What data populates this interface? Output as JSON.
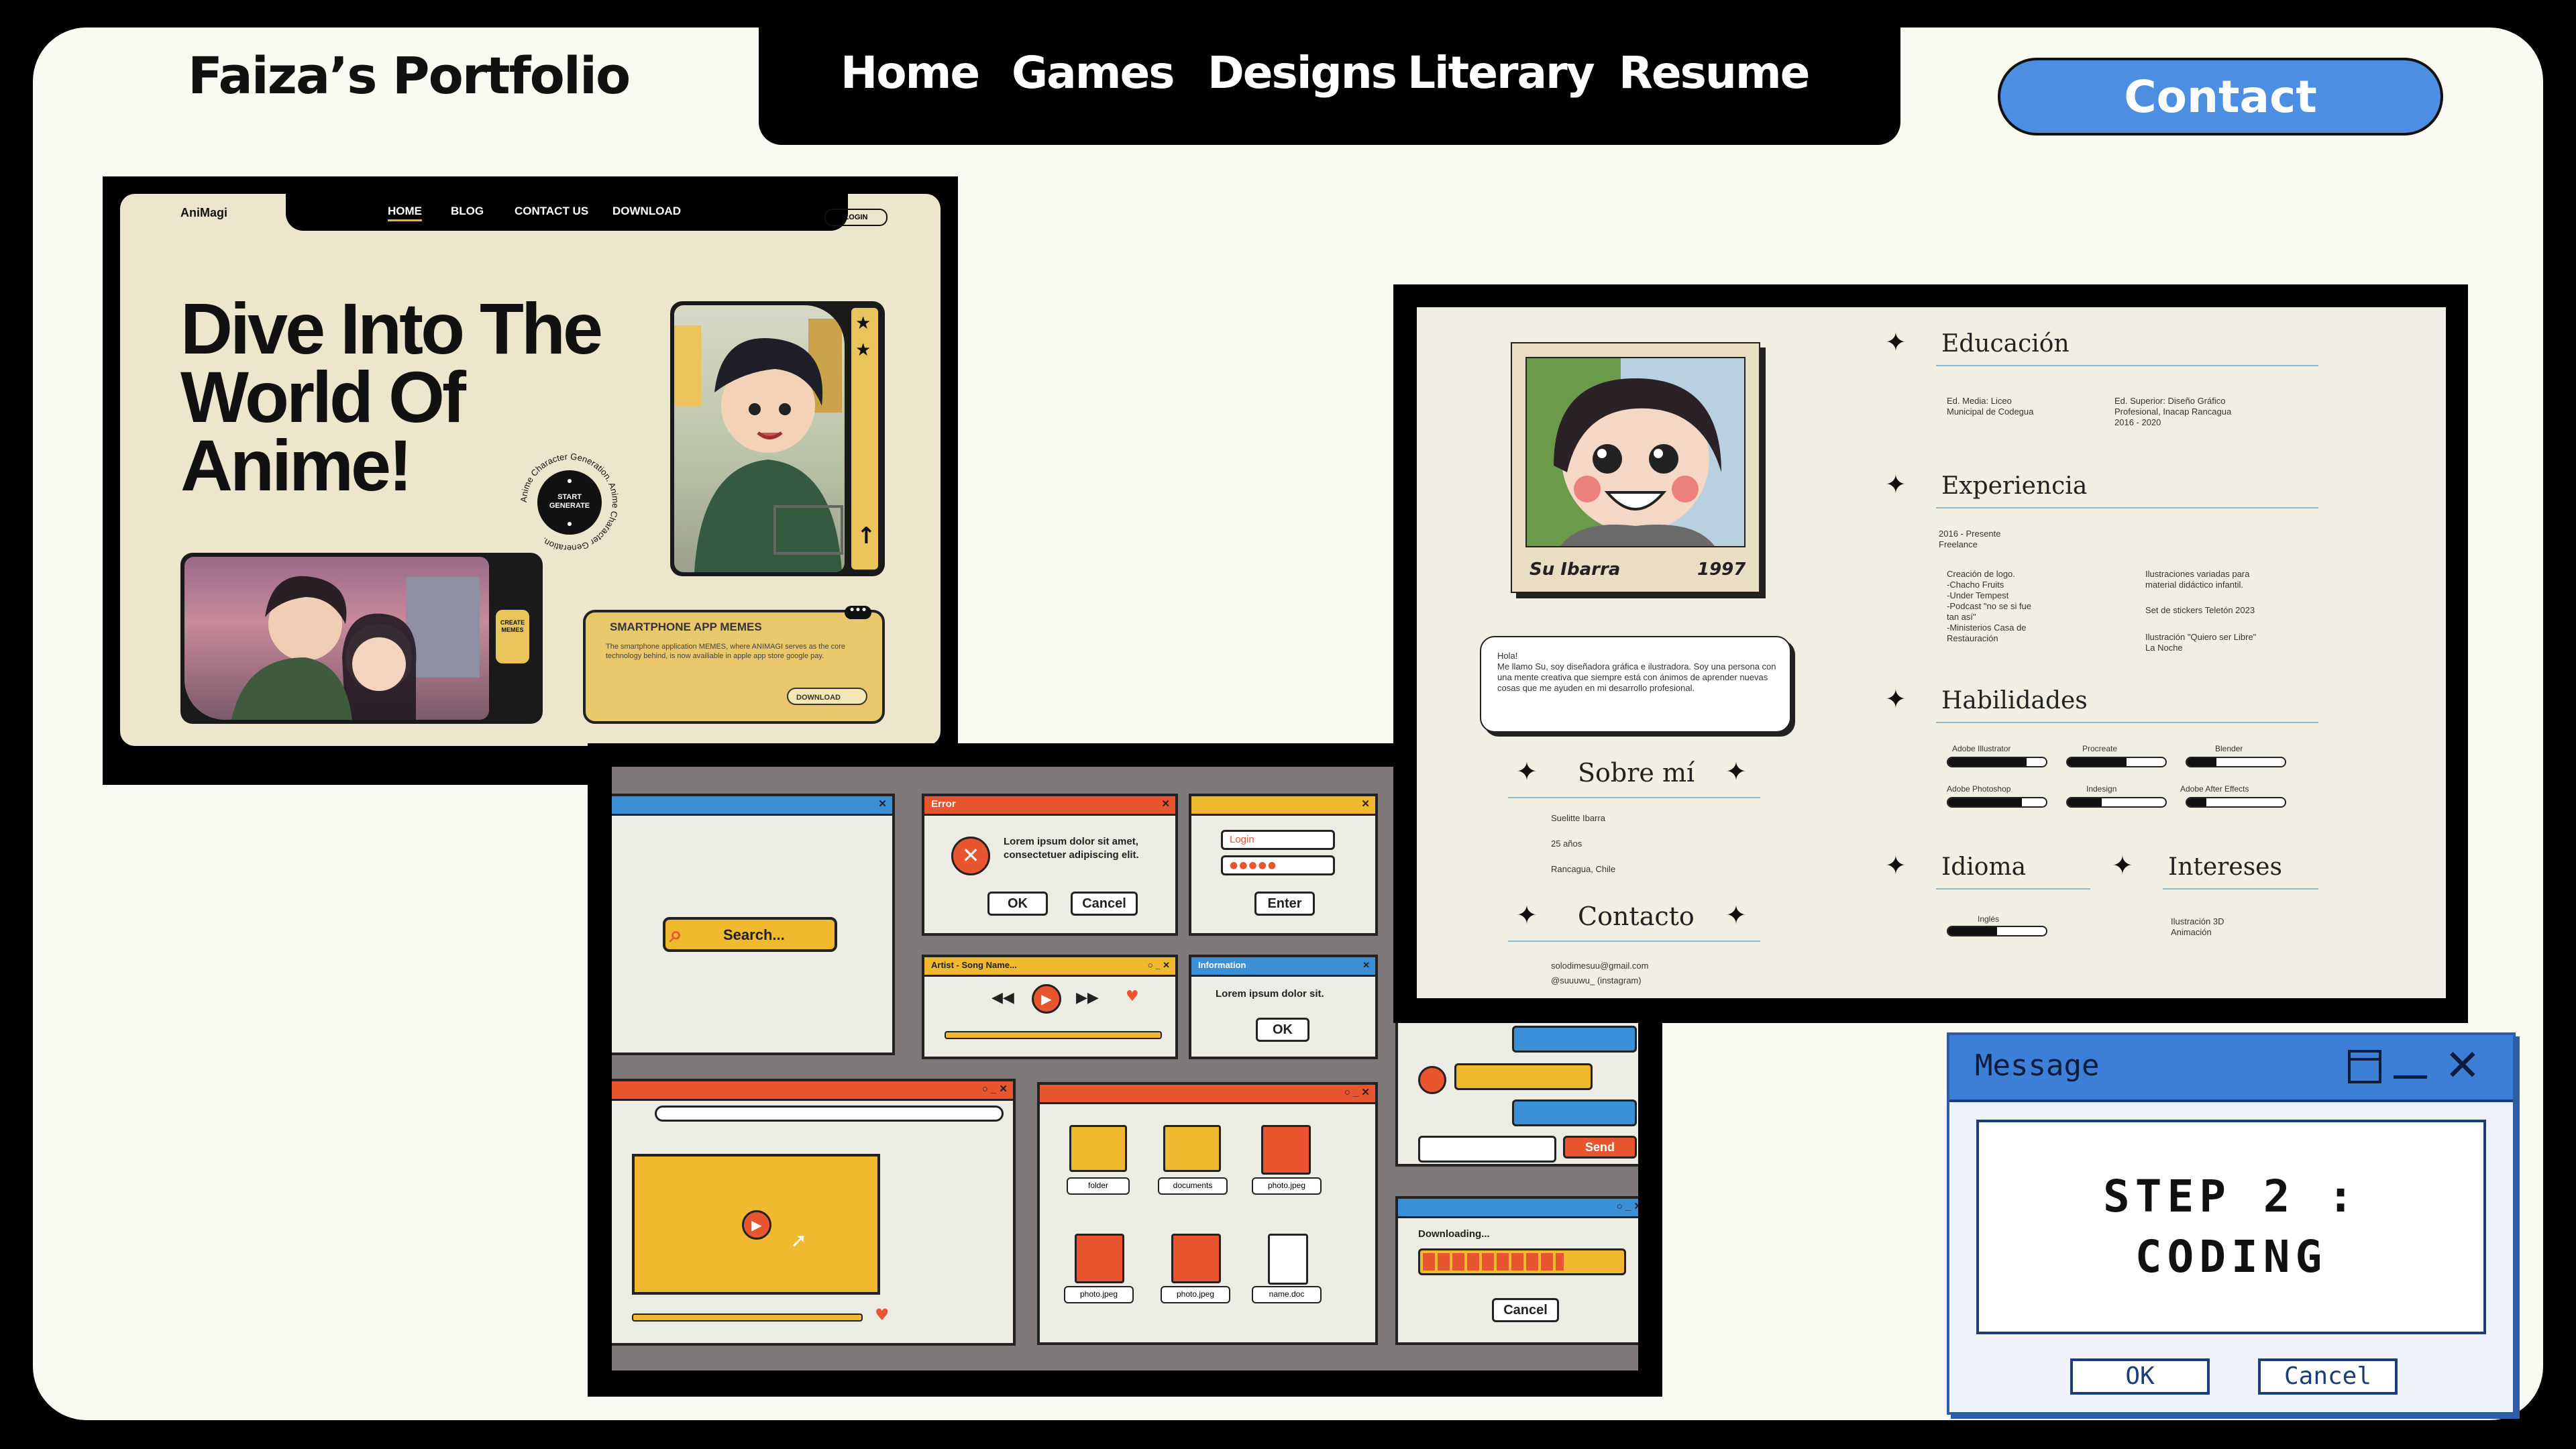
{
  "site": {
    "title": "Faiza’s Portfolio",
    "nav": [
      "Home",
      "Games",
      "Designs",
      "Literary",
      "Resume"
    ],
    "contact_label": "Contact"
  },
  "animagi": {
    "brand": "AniMagi",
    "nav": [
      "HOME",
      "BLOG",
      "CONTACT US",
      "DOWNLOAD"
    ],
    "login": "LOGIN",
    "hero_lines": [
      "Dive Into The",
      "World Of",
      "Anime!"
    ],
    "badge_text": "START GENERATE",
    "badge_ring": "Anime Character Generation. Anime Character Generation.",
    "create_memes": "CREATE MEMES",
    "app_title": "SMARTPHONE APP MEMES",
    "app_desc": "The smartphone application MEMES, where ANIMAGI serves as the core technology behind, is now availiable in apple app store google pay.",
    "download": "DOWNLOAD"
  },
  "resume": {
    "polaroid_name": "Su Ibarra",
    "polaroid_year": "1997",
    "bubble": "Hola!\nMe llamo Su, soy diseñadora gráfica e ilustradora. Soy una persona con una mente creativa que siempre está con ánimos de aprender nuevas cosas que me ayuden en mi desarrollo profesional.",
    "sobre_title": "Sobre mí",
    "sobre_lines": [
      "Suelitte Ibarra",
      "25 años",
      "Rancagua, Chile"
    ],
    "contacto_title": "Contacto",
    "contacto_lines": [
      "solodimesuu@gmail.com",
      "@suuuwu_ (instagram)"
    ],
    "educacion_title": "Educación",
    "edu_1": "Ed. Media: Liceo\nMunicipal de Codegua",
    "edu_2": "Ed. Superior: Diseño Gráfico\nProfesional, Inacap Rancagua\n2016 - 2020",
    "experiencia_title": "Experiencia",
    "exp_period": "2016 - Presente\nFreelance",
    "exp_1": "Creación de logo.\n-Chacho Fruits\n-Under Tempest\n-Podcast \"no se si fue\ntan así\"\n-Ministerios Casa de\nRestauración",
    "exp_2": "Ilustraciones variadas para\nmaterial didáctico infantil.",
    "exp_3": "Set de stickers Teletón 2023",
    "exp_4": "Ilustración \"Quiero ser Libre\"\nLa Noche",
    "habilidades_title": "Habilidades",
    "skills": [
      {
        "name": "Adobe Illustrator",
        "level": 0.8
      },
      {
        "name": "Procreate",
        "level": 0.6
      },
      {
        "name": "Blender",
        "level": 0.3
      },
      {
        "name": "Adobe Photoshop",
        "level": 0.75
      },
      {
        "name": "Indesign",
        "level": 0.35
      },
      {
        "name": "Adobe After Effects",
        "level": 0.2
      }
    ],
    "idioma_title": "Idioma",
    "idioma": {
      "name": "Inglés",
      "level": 0.5
    },
    "intereses_title": "Intereses",
    "intereses": "Ilustración      3D\nAnimación"
  },
  "retro": {
    "search": "Search...",
    "error_title": "Error",
    "error_text": "Lorem ipsum dolor sit amet, consectetuer adipiscing elit.",
    "ok": "OK",
    "cancel": "Cancel",
    "login_title": "Login",
    "login_field": "Login",
    "password_mask": "●●●●●",
    "enter": "Enter",
    "player_title": "Artist - Song Name...",
    "info_title": "Information",
    "info_text": "Lorem ipsum dolor sit.",
    "send": "Send",
    "folder": "folder",
    "documents": "documents",
    "photo": "photo.jpeg",
    "doc": "name.doc",
    "downloading": "Downloading...",
    "cancel_lower": "Cancel"
  },
  "dialog": {
    "title": "Message",
    "line1": "STEP 2 :",
    "line2": "CODING",
    "ok": "OK",
    "cancel": "Cancel"
  },
  "colors": {
    "accent_blue": "#4b8ee2",
    "cream": "#fbfaf2",
    "retro_orange": "#e8552f",
    "retro_yellow": "#f0b930",
    "retro_blue": "#3a8fd6"
  }
}
